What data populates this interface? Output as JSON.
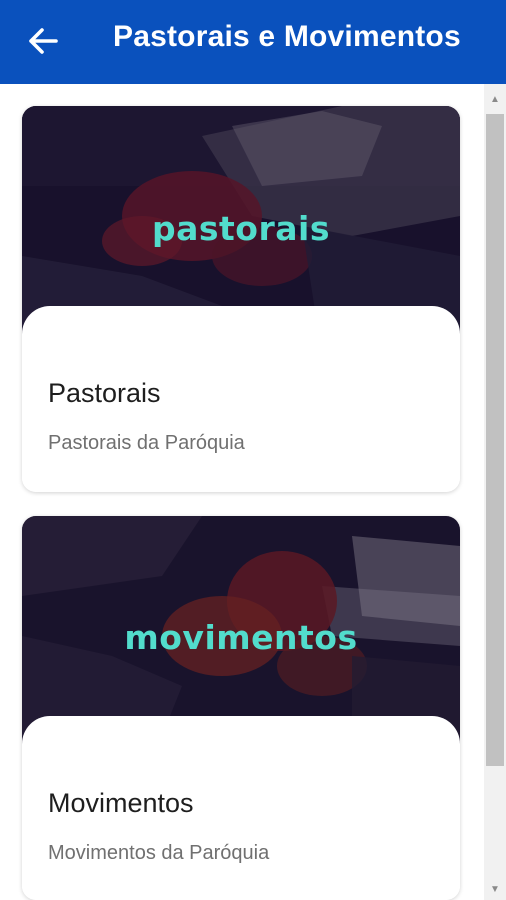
{
  "header": {
    "title": "Pastorais e Movimentos",
    "back_icon": "arrow-left-icon",
    "background": "#0a51bd"
  },
  "cards": [
    {
      "image_word": "pastorais",
      "title": "Pastorais",
      "subtitle": "Pastorais da Paróquia"
    },
    {
      "image_word": "movimentos",
      "title": "Movimentos",
      "subtitle": "Movimentos da Paróquia"
    }
  ],
  "colors": {
    "accent_text": "#52dccc",
    "image_overlay": "#1a1330"
  },
  "scrollbar": {
    "up_icon": "scroll-up-arrow-icon",
    "down_icon": "scroll-down-arrow-icon"
  }
}
